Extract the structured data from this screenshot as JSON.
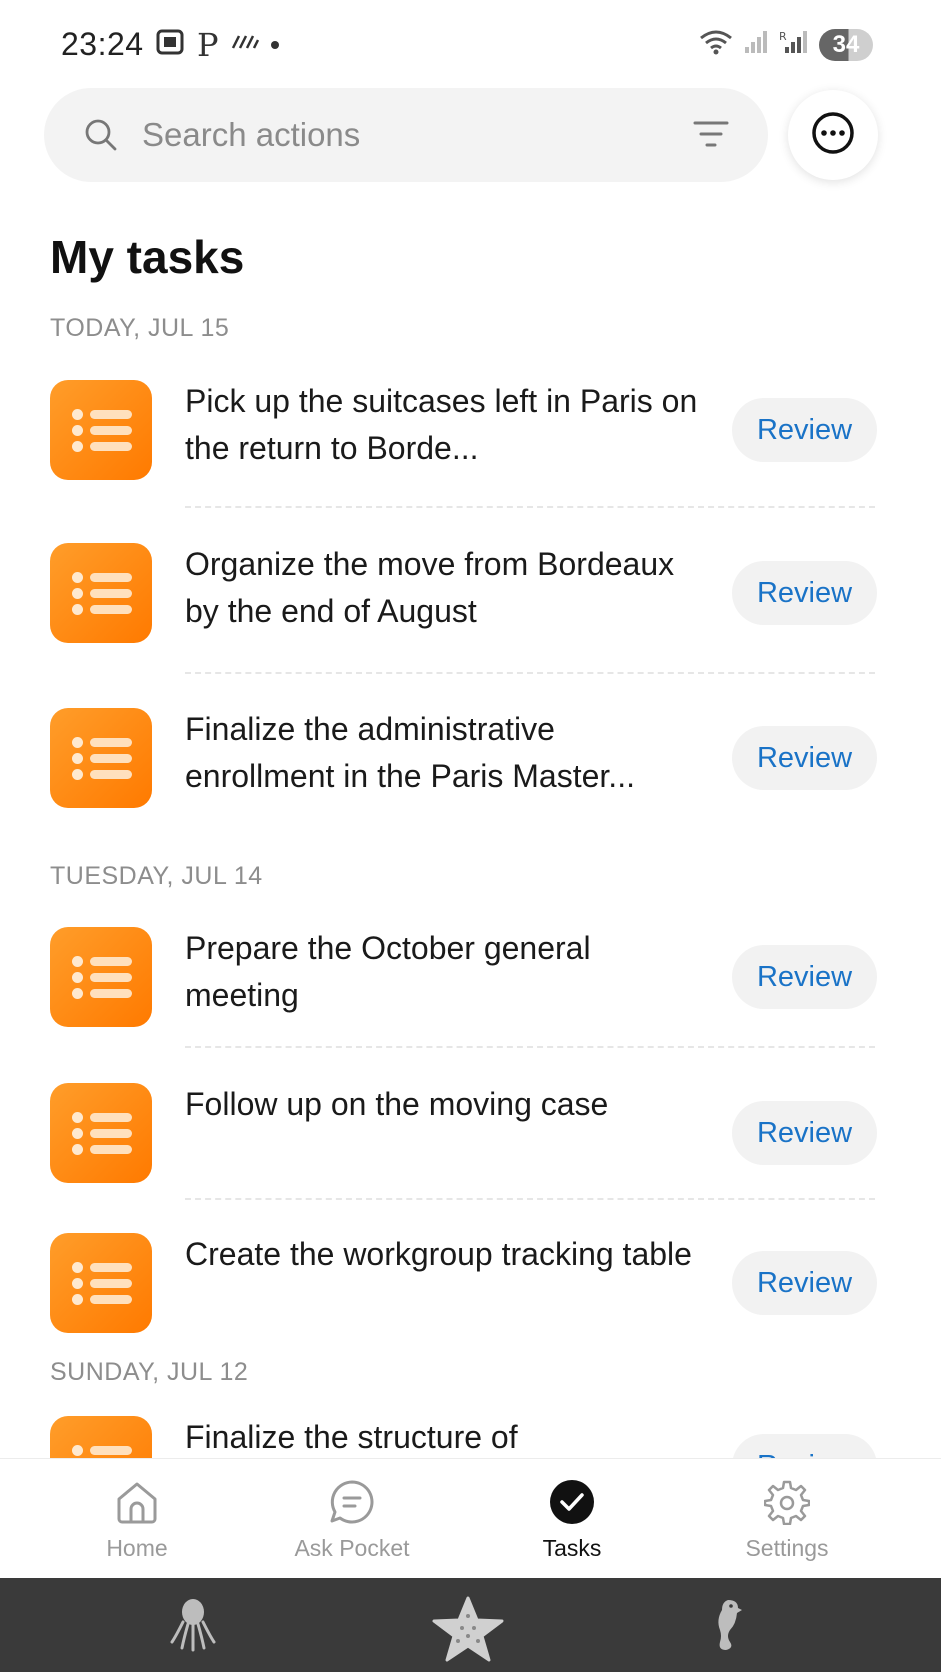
{
  "status_bar": {
    "time": "23:24",
    "p_glyph": "P",
    "battery": "34",
    "icons": [
      "screenshot-icon",
      "p-glyph",
      "signal-stripes-icon",
      "wifi-icon",
      "cell-signal-icon",
      "cell-signal-roaming-icon",
      "battery-icon"
    ]
  },
  "search": {
    "placeholder": "Search actions"
  },
  "page": {
    "title": "My tasks"
  },
  "sections": [
    {
      "label": "TODAY, JUL 15",
      "tasks": [
        {
          "title": "Pick up the suitcases left in Paris on the return to Borde...",
          "action": "Review"
        },
        {
          "title": "Organize the move from Bordeaux by the end of August",
          "action": "Review"
        },
        {
          "title": "Finalize the administrative enrollment in the Paris Master...",
          "action": "Review"
        }
      ]
    },
    {
      "label": "TUESDAY, JUL 14",
      "tasks": [
        {
          "title": "Prepare the October general meeting",
          "action": "Review"
        },
        {
          "title": "Follow up on the moving case",
          "action": "Review"
        },
        {
          "title": "Create the workgroup tracking table",
          "action": "Review"
        }
      ]
    },
    {
      "label": "SUNDAY, JUL 12",
      "tasks": [
        {
          "title": "Finalize the structure of",
          "action": "Review"
        }
      ]
    }
  ],
  "bottom_nav": {
    "items": [
      {
        "label": "Home",
        "icon": "home-icon"
      },
      {
        "label": "Ask Pocket",
        "icon": "chat-bubble-icon"
      },
      {
        "label": "Tasks",
        "icon": "check-circle-icon"
      },
      {
        "label": "Settings",
        "icon": "gear-icon"
      }
    ],
    "active": "Tasks"
  },
  "system_nav": {
    "icons": [
      "octopus-icon",
      "starfish-icon",
      "seahorse-icon"
    ]
  },
  "colors": {
    "accent_orange": "#ff8a12",
    "link_blue": "#1a73c7",
    "section_gray": "#8d8d8d"
  }
}
